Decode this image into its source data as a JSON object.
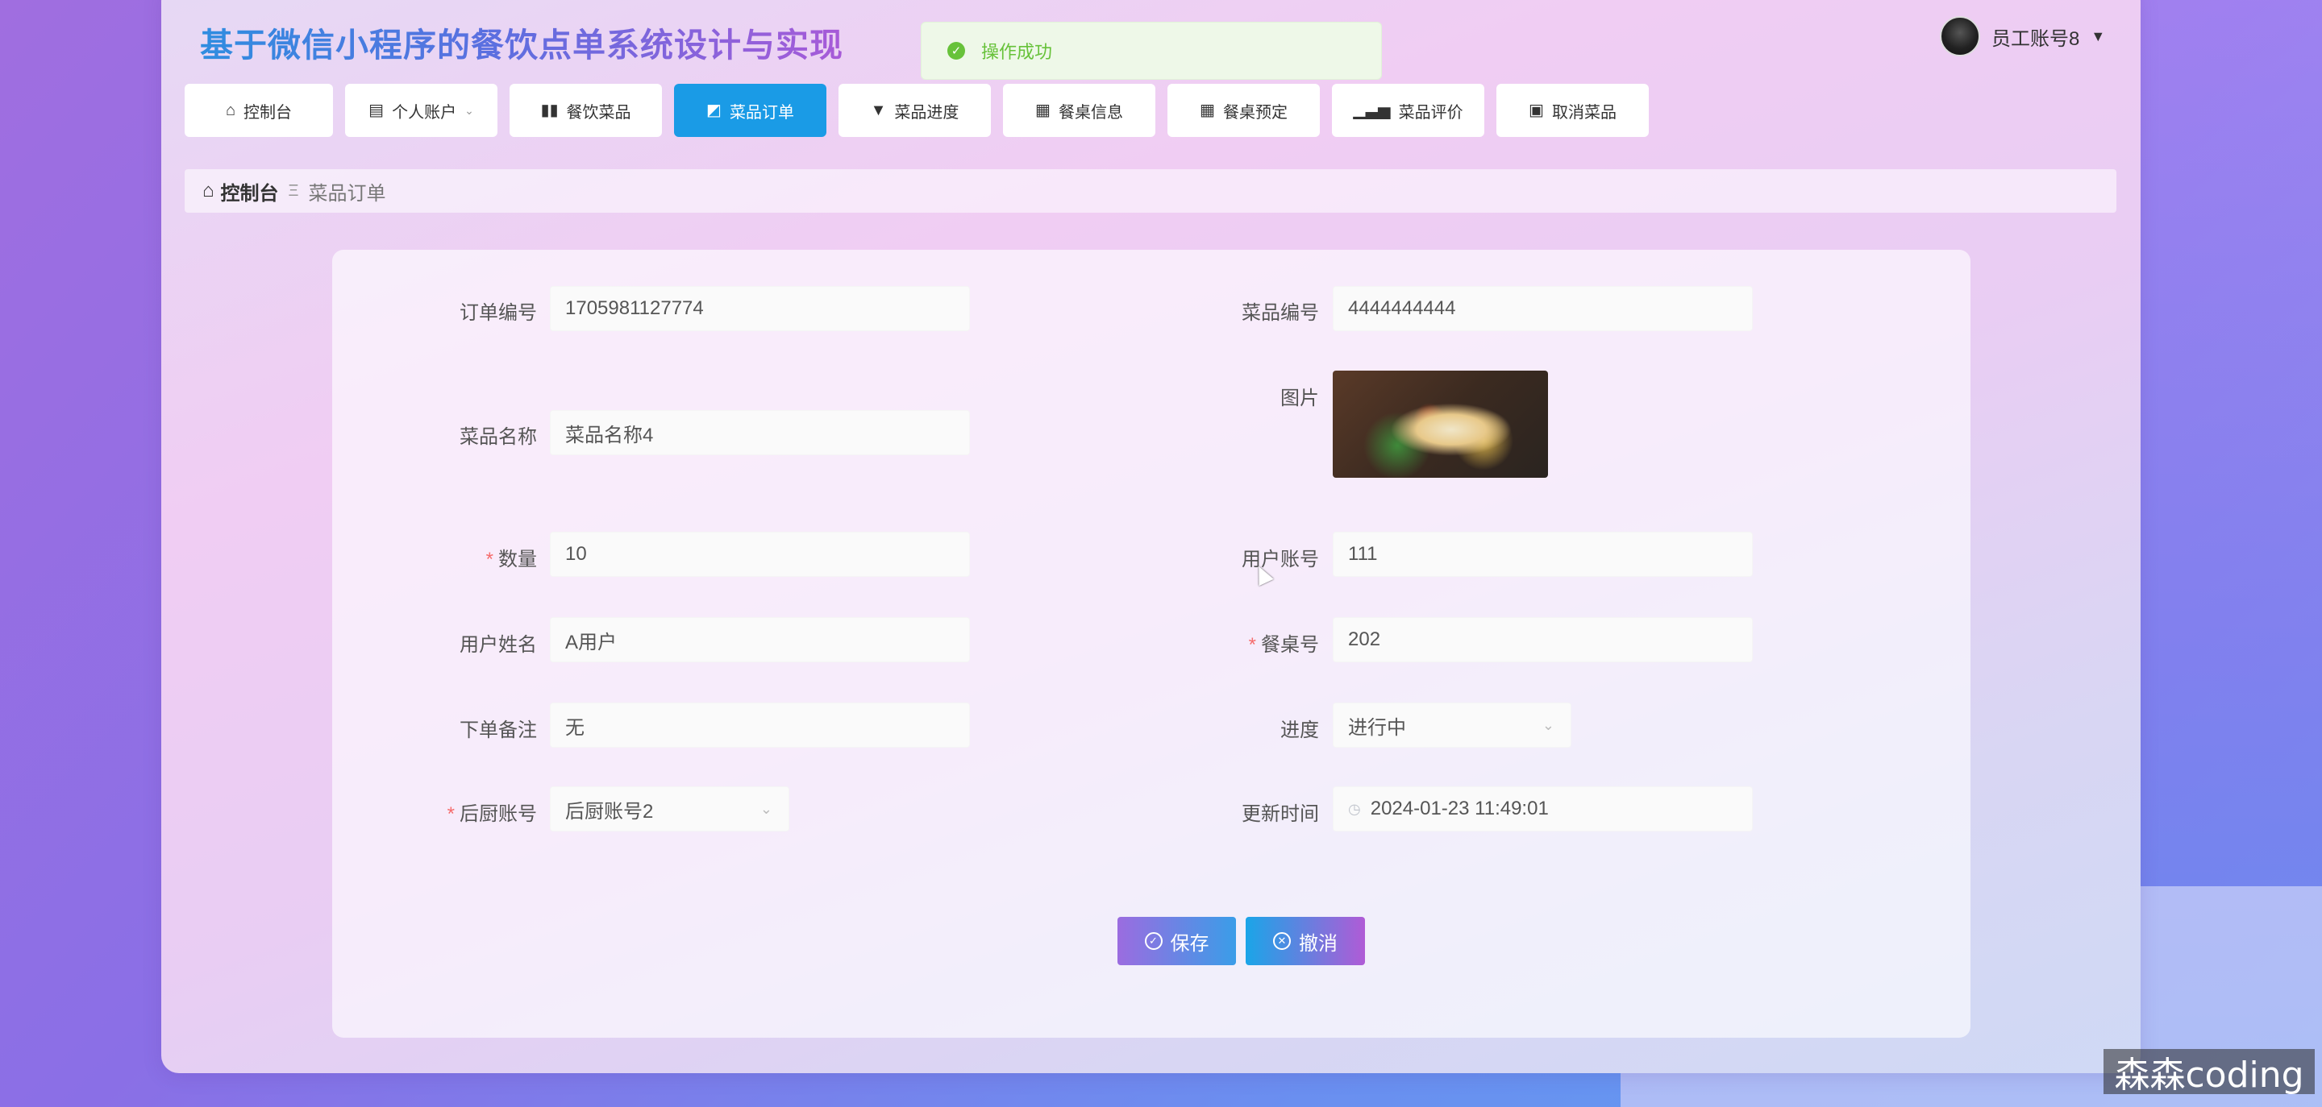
{
  "header": {
    "app_title": "基于微信小程序的餐饮点单系统设计与实现",
    "user_name": "员工账号8",
    "user_caret": "▼"
  },
  "toast": {
    "message": "操作成功",
    "status_color": "#67c23a"
  },
  "nav": {
    "tabs": [
      {
        "label": "控制台",
        "icon": "home-icon"
      },
      {
        "label": "个人账户",
        "icon": "calendar-icon",
        "has_dropdown": true
      },
      {
        "label": "餐饮菜品",
        "icon": "bars-icon"
      },
      {
        "label": "菜品订单",
        "icon": "chart-icon",
        "active": true
      },
      {
        "label": "菜品进度",
        "icon": "brush-icon"
      },
      {
        "label": "餐桌信息",
        "icon": "grid-icon"
      },
      {
        "label": "餐桌预定",
        "icon": "grid-icon"
      },
      {
        "label": "菜品评价",
        "icon": "bar-chart-icon"
      },
      {
        "label": "取消菜品",
        "icon": "clipboard-icon"
      }
    ],
    "active_color": "#1a9be6"
  },
  "breadcrumb": {
    "home": "控制台",
    "separator": "Ξ",
    "current": "菜品订单"
  },
  "form": {
    "order_no": {
      "label": "订单编号",
      "value": "1705981127774"
    },
    "dish_no": {
      "label": "菜品编号",
      "value": "4444444444"
    },
    "dish_name": {
      "label": "菜品名称",
      "value": "菜品名称4"
    },
    "image": {
      "label": "图片"
    },
    "quantity": {
      "label": "数量",
      "value": "10",
      "required": "*"
    },
    "user_account": {
      "label": "用户账号",
      "value": "111"
    },
    "user_name": {
      "label": "用户姓名",
      "value": "A用户"
    },
    "table_no": {
      "label": "餐桌号",
      "value": "202",
      "required": "*"
    },
    "order_note": {
      "label": "下单备注",
      "value": "无"
    },
    "progress": {
      "label": "进度",
      "value": "进行中"
    },
    "kitchen_account": {
      "label": "后厨账号",
      "value": "后厨账号2",
      "required": "*"
    },
    "update_time": {
      "label": "更新时间",
      "value": "2024-01-23 11:49:01"
    }
  },
  "actions": {
    "save_label": "保存",
    "cancel_label": "撤消"
  },
  "watermark": "森森coding"
}
